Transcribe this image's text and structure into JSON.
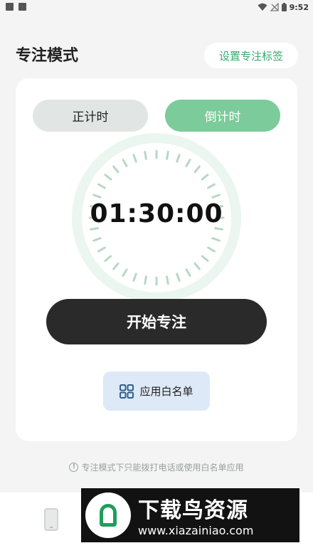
{
  "status_bar": {
    "time": "9:52"
  },
  "header": {
    "title": "专注模式",
    "tag_button": "设置专注标签"
  },
  "modes": [
    {
      "label": "正计时",
      "active": false
    },
    {
      "label": "倒计时",
      "active": true
    }
  ],
  "timer": {
    "display": "01:30:00"
  },
  "start_button": "开始专注",
  "whitelist_button": "应用白名单",
  "tip": {
    "icon": "!",
    "text": "专注模式下只能拨打电话或使用白名单应用"
  },
  "bottom_nav": {
    "icons": [
      "phone-icon"
    ]
  },
  "watermark": {
    "title": "下载鸟资源",
    "url": "www.xiazainiao.com"
  },
  "colors": {
    "accent": "#7ccb9b",
    "accent_text": "#3aa86d",
    "dark_button": "#2a2a2a",
    "whitelist_bg": "#dde9f6",
    "background": "#f3f4f3"
  }
}
